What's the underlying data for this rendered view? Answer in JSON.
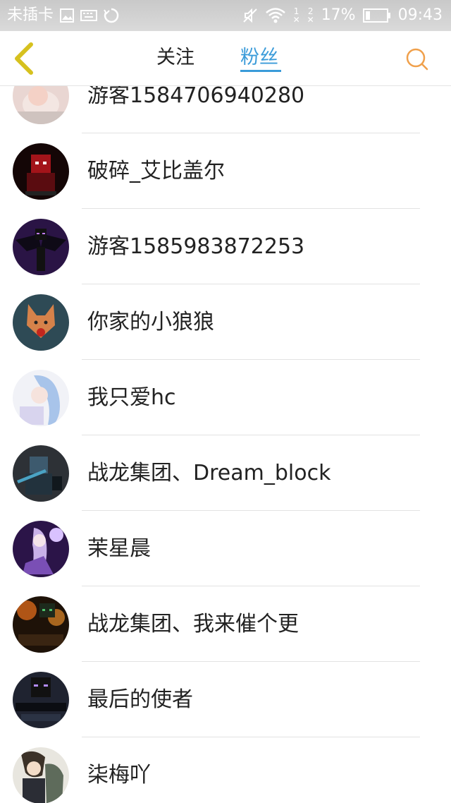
{
  "status_bar": {
    "carrier": "未插卡",
    "sim1": "1",
    "sim2": "2",
    "battery": "17%",
    "time": "09:43"
  },
  "header": {
    "tabs": [
      {
        "label": "关注",
        "active": false
      },
      {
        "label": "粉丝",
        "active": true
      }
    ],
    "accent_color": "#3a9bd9",
    "back_icon": "chevron-left-icon",
    "search_icon": "search-icon"
  },
  "fans": [
    {
      "name": "游客1584706940280"
    },
    {
      "name": "破碎_艾比盖尔"
    },
    {
      "name": "游客1585983872253"
    },
    {
      "name": "你家的小狼狼"
    },
    {
      "name": "我只爱hc"
    },
    {
      "name": "战龙集团、Dream_block"
    },
    {
      "name": "茉星晨"
    },
    {
      "name": "战龙集团、我来催个更"
    },
    {
      "name": "最后的使者"
    },
    {
      "name": "柒梅吖"
    }
  ]
}
